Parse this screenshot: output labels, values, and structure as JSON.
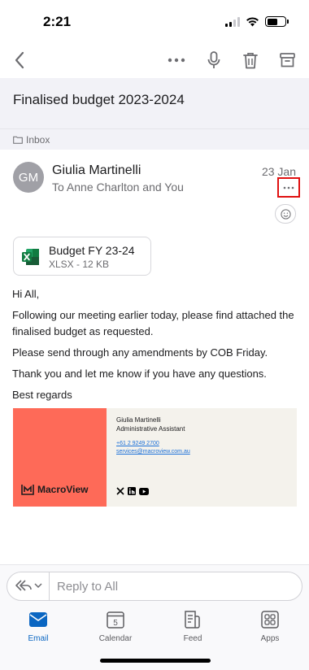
{
  "status_bar": {
    "time": "2:21"
  },
  "toolbar": {
    "back_icon": "chevron-left-icon",
    "more_icon": "more-horizontal-icon",
    "mic_icon": "microphone-icon",
    "delete_icon": "trash-icon",
    "archive_icon": "archive-icon"
  },
  "email": {
    "subject": "Finalised budget 2023-2024",
    "folder": "Inbox",
    "sender": {
      "initials": "GM",
      "name": "Giulia Martinelli",
      "recipients": "To Anne Charlton and You",
      "date": "23 Jan"
    },
    "attachment": {
      "name": "Budget FY 23-24",
      "meta": "XLSX - 12 KB",
      "icon": "excel-icon"
    },
    "body": [
      "Hi All,",
      "Following our meeting earlier today, please find attached the finalised budget as requested.",
      "Please send through any amendments by COB Friday.",
      "Thank you and let me know if you have any questions.",
      "Best regards"
    ],
    "signature": {
      "brand": "MacroView",
      "name": "Giulia Martinelli",
      "role": "Administrative Assistant",
      "phone": "+61 2 9249 2700",
      "email": "services@macroview.com.au",
      "social_icons": [
        "x-icon",
        "linkedin-icon",
        "youtube-icon"
      ],
      "brand_color": "#fe6a58"
    }
  },
  "reply": {
    "placeholder": "Reply to All"
  },
  "tabs": [
    {
      "label": "Email",
      "icon": "mail-icon",
      "active": true
    },
    {
      "label": "Calendar",
      "icon": "calendar-icon",
      "day": "5"
    },
    {
      "label": "Feed",
      "icon": "feed-icon"
    },
    {
      "label": "Apps",
      "icon": "apps-icon"
    }
  ],
  "colors": {
    "accent": "#0a66c2",
    "highlight_box": "#e01010"
  }
}
